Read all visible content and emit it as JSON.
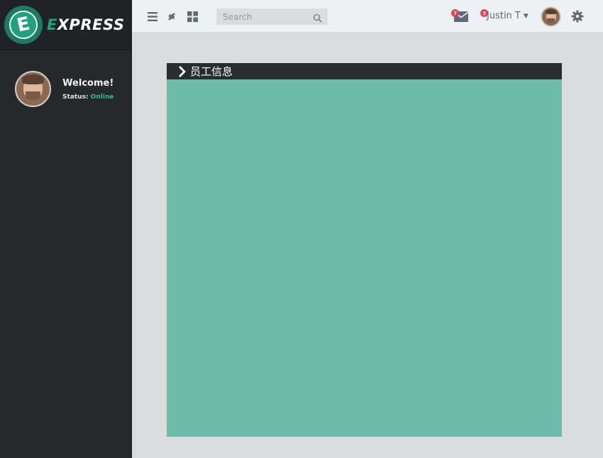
{
  "brand": {
    "logo_letter": "E",
    "name_first": "E",
    "name_rest": "XPRESS"
  },
  "profile": {
    "welcome": "Welcome!",
    "status_label": "Status:",
    "status_value": "Online"
  },
  "topbar": {
    "icons": [
      "menu-icon",
      "refresh-icon",
      "grid-icon"
    ],
    "search": {
      "placeholder": "Search",
      "value": ""
    },
    "mail_count": "7",
    "notif_count": "3",
    "user_name": "Justin T",
    "caret": "⌄"
  },
  "panel": {
    "title": "员工信息"
  },
  "colors": {
    "accent": "#24a07f",
    "panel_body": "#6dbcab",
    "badge": "#e2424d",
    "sidebar": "#25282c"
  }
}
